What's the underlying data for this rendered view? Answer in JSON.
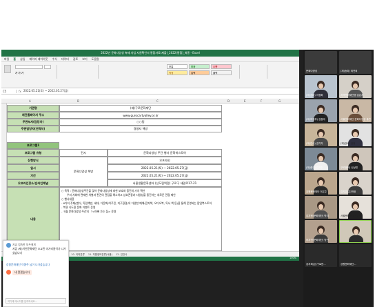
{
  "excel": {
    "title": "2022년 문화다양성 축제 사업 지원확인서 통합자료(제출)_2022(통합)_최종 - Excel",
    "tabs": [
      "파일",
      "홈",
      "삽입",
      "페이지 레이아웃",
      "수식",
      "데이터",
      "검토",
      "보기",
      "도움말"
    ],
    "cell_styles": [
      "보통",
      "좋음",
      "나쁨",
      "적정",
      "입력",
      "출력"
    ],
    "name_box": "C5",
    "formula": "2022.05.21(토) ~ 2022.05.27(금)",
    "columns": [
      "A",
      "B",
      "C",
      "D",
      "E",
      "F",
      "G"
    ],
    "rows": {
      "organizer_label": "기관명",
      "organizer_value": "(재)구로문화재단",
      "site_label": "재단홈페이지 주소",
      "site_value": "www.gurocartvalley.or.kr",
      "manager_label": "주관부서(담당자)",
      "manager_value": "○○팀",
      "contact_label": "주관담당자(연락처)",
      "contact_value": "경영지 책방",
      "program_header": "프로그램1",
      "type_label": "프로그램 유형",
      "type_value": "전시",
      "name_value": "문화다양성 주간 행사 문화북스토어",
      "method_label": "진행방식",
      "method_value": "오프라인",
      "date_label": "일시",
      "date_value": "2022.05.21(토) ~ 2022.05.27(금)",
      "period_label": "기간",
      "period_value": "2022.05.21(토) ~ 2022.05.27(금)",
      "place_label": "오프라인장소/온라인채널",
      "place_value": "서울생활문화센터 (신도림역점) 구로구 새말로17-21",
      "group_label": "문화다양성 책방",
      "content_label": "내용",
      "content_lines": [
        "○ 목적 : 문화다양성주간을 맞아 문화다양성에 대한 보호와 증진의 가치 확산",
        "우리 사회에 편재한 차별과 편견의 관점을 해소하고 상호존중과 다양성을 증진하는 새로운 관점 제안",
        "○ 행사내용",
        "- 6가지 주제(젠더, 독립책방, 세대, 다문화/이주민, 지구환경)의 다양한 매체(전자책, 오디오북, 독서 책 등)을 통해 운영되는 팝업북스토어",
        "- 북큐 식도용 문화 이벤트 운영",
        "- '5월 문화다양성 주간의 『<아빠 가는 집> 운영"
      ]
    },
    "sheet_tabs": [
      "1. 종합본",
      "4. 단상",
      "7. 재정",
      "8. 구축",
      "9. 구두",
      "10. 이외분류",
      "11. 지원정보분류(서울)",
      "12. 인천사"
    ],
    "zoom": "100%"
  },
  "video": {
    "participants": [
      "문화다양성",
      "(재)송파) 최연희",
      "(재)송파) 이정희",
      "지역문화재단명 김은지",
      "(재)의정부) 김정아",
      "서울문화재단 문화다양성 홍민",
      "(재)연수) 권기자",
      "(재)강서) 김정",
      "(재)중구) 김지수",
      "구로문화) 신상민",
      "강원문화재단 이은주",
      "김지은(은)학정",
      "김지현(문화재단) 박미",
      "서울문화재단 오은영",
      "하지연(문화재단) 방연",
      "강지희(은)구로문...",
      "강원문화재단..."
    ]
  },
  "notification": {
    "title": "지금 접속한 모두에게",
    "message": "지금 (제)이천문화재단 조교민 미가리원이가 나가셨습니다",
    "sender_line": "강원문화재단 이홍주 님이 나가셨습니다",
    "message2": "네 알겠습니다",
    "input_placeholder": "여기에 메시지를 입력하세요..."
  }
}
